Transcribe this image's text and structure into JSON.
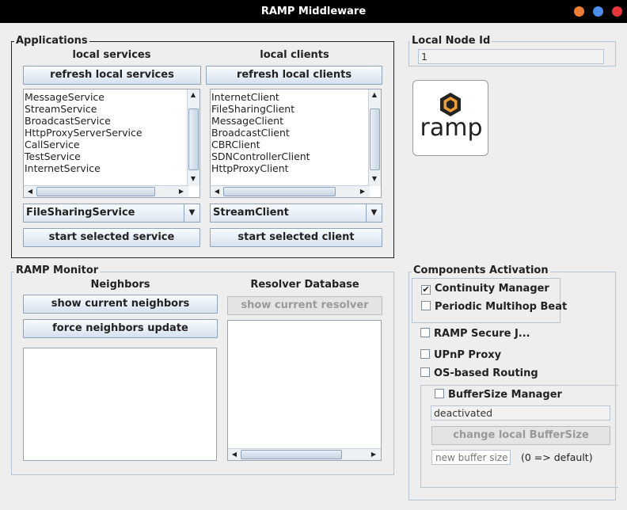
{
  "window": {
    "title": "RAMP Middleware",
    "controls": {
      "minimize_color": "#ef7d32",
      "maximize_color": "#4b8ef0",
      "close_color": "#e8353a"
    }
  },
  "applications": {
    "legend": "Applications",
    "services": {
      "header": "local services",
      "refresh_label": "refresh local services",
      "items": [
        "MessageService",
        "StreamService",
        "BroadcastService",
        "HttpProxyServerService",
        "CallService",
        "TestService",
        "InternetService"
      ],
      "selected": "FileSharingService",
      "start_label": "start selected service"
    },
    "clients": {
      "header": "local clients",
      "refresh_label": "refresh local clients",
      "items": [
        "InternetClient",
        "FileSharingClient",
        "MessageClient",
        "BroadcastClient",
        "CBRClient",
        "SDNControllerClient",
        "HttpProxyClient"
      ],
      "selected": "StreamClient",
      "start_label": "start selected client"
    }
  },
  "local_node": {
    "legend": "Local Node Id",
    "value": "1"
  },
  "logo": {
    "text": "ramp",
    "icon": "hexagon-logo-icon",
    "accent": "#f0a030"
  },
  "monitor": {
    "legend": "RAMP Monitor",
    "neighbors": {
      "header": "Neighbors",
      "show_label": "show current neighbors",
      "force_label": "force neighbors update"
    },
    "resolver": {
      "header": "Resolver Database",
      "show_label": "show current resolver"
    }
  },
  "components": {
    "legend": "Components Activation",
    "continuity": {
      "label": "Continuity Manager",
      "checked": "✔"
    },
    "multihop": {
      "label": "Periodic Multihop Beat"
    },
    "secure": {
      "label": "RAMP Secure J..."
    },
    "upnp": {
      "label": "UPnP Proxy"
    },
    "routing": {
      "label": "OS-based Routing"
    },
    "buffer": {
      "label": "BufferSize Manager",
      "status": "deactivated",
      "change_label": "change local BufferSize",
      "size_placeholder": "new buffer size",
      "hint": "(0 => default)"
    }
  }
}
